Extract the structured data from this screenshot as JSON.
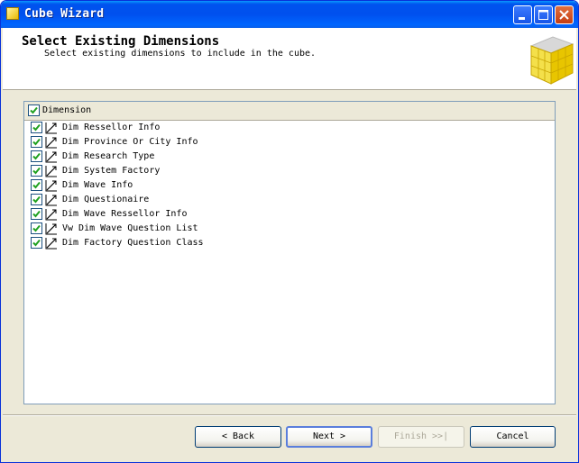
{
  "window": {
    "title": "Cube Wizard"
  },
  "header": {
    "title": "Select Existing Dimensions",
    "subtitle": "Select existing dimensions to include in the cube."
  },
  "list": {
    "header_label": "Dimension",
    "header_checked": true,
    "items": [
      {
        "label": "Dim Ressellor Info",
        "checked": true
      },
      {
        "label": "Dim Province Or City Info",
        "checked": true
      },
      {
        "label": "Dim Research Type",
        "checked": true
      },
      {
        "label": "Dim System Factory",
        "checked": true
      },
      {
        "label": "Dim Wave Info",
        "checked": true
      },
      {
        "label": "Dim Questionaire",
        "checked": true
      },
      {
        "label": "Dim Wave Ressellor Info",
        "checked": true
      },
      {
        "label": "Vw Dim Wave Question List",
        "checked": true
      },
      {
        "label": "Dim Factory Question Class",
        "checked": true
      }
    ]
  },
  "buttons": {
    "back": "< Back",
    "next": "Next >",
    "finish": "Finish >>|",
    "cancel": "Cancel"
  },
  "colors": {
    "titlebar": "#0053ee",
    "check": "#21a121",
    "face": "#ece9d8"
  }
}
